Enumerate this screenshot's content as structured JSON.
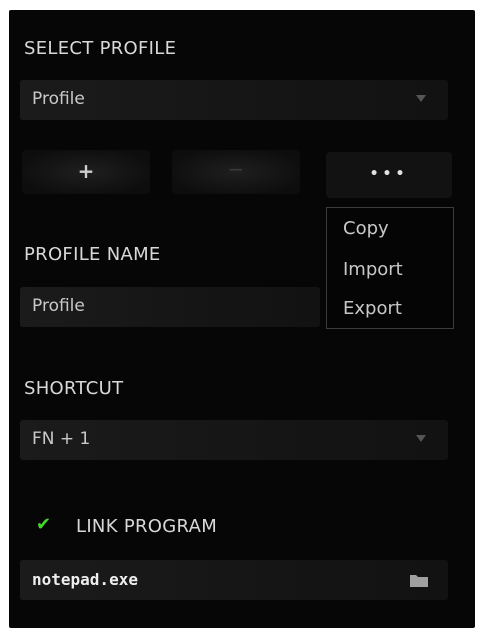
{
  "select_profile": {
    "label": "SELECT PROFILE",
    "selected": "Profile",
    "dropdown_icon": "chevron-down-icon"
  },
  "actions": {
    "add_glyph": "+",
    "remove_glyph": "−",
    "more_glyph": "•••"
  },
  "more_menu": {
    "items": [
      "Copy",
      "Import",
      "Export"
    ]
  },
  "profile_name": {
    "label": "PROFILE NAME",
    "value": "Profile"
  },
  "shortcut": {
    "label": "SHORTCUT",
    "selected": "FN + 1",
    "dropdown_icon": "chevron-down-icon"
  },
  "link_program": {
    "label": "LINK PROGRAM",
    "checked": true,
    "check_color": "#44d62c",
    "program": "notepad.exe",
    "browse_icon": "folder-icon"
  }
}
